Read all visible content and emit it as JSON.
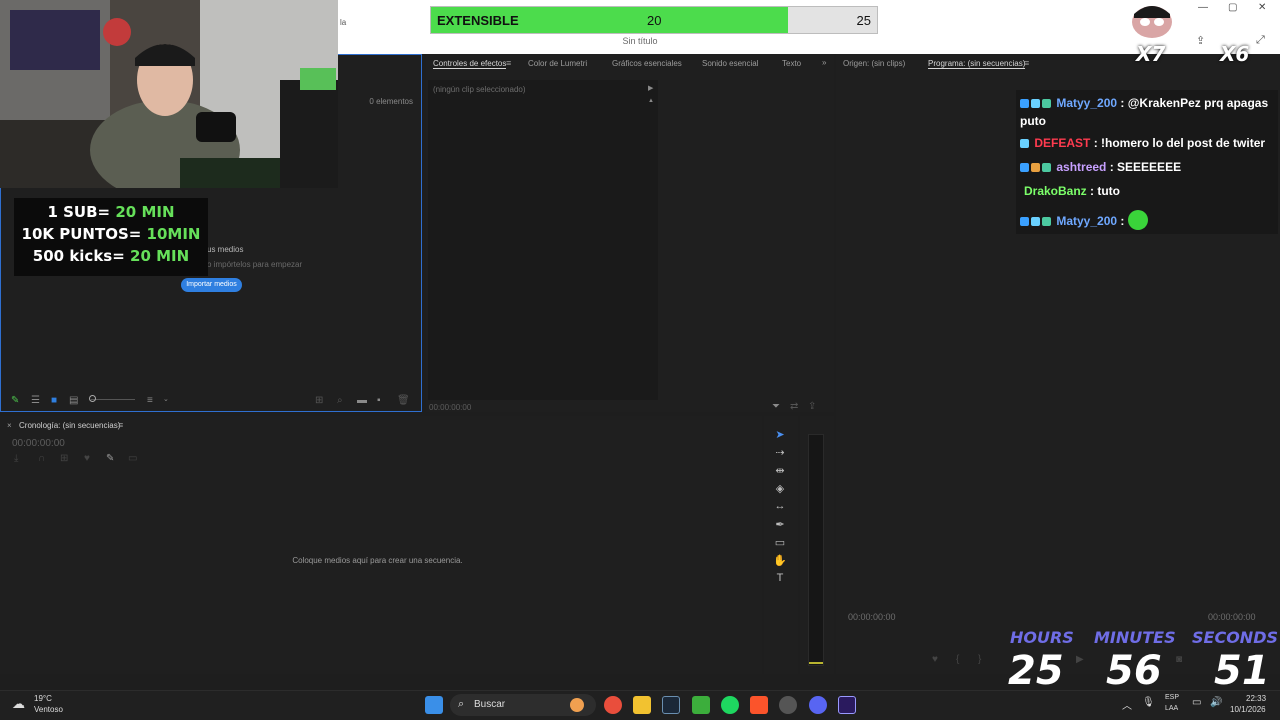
{
  "window": {
    "document_title": "Sin título",
    "partial_text": "la"
  },
  "goal_bar": {
    "label": "EXTENSIBLE",
    "current": "20",
    "target": "25",
    "progress_fraction": 0.8,
    "fill_color": "#4cdc4c"
  },
  "project_panel": {
    "item_count": "0 elementos",
    "empty_title_partial": "us medios",
    "empty_hint_partial": "o impórtelos para empezar",
    "import_button": "Importar medios",
    "accent_color": "#2f7fe0"
  },
  "effects_panel": {
    "tabs": [
      "Controles de efectos",
      "Color de Lumetri",
      "Gráficos esenciales",
      "Sonido esencial",
      "Texto"
    ],
    "no_clip": "(ningún clip seleccionado)",
    "timecode": "00:00:00:00"
  },
  "monitors": {
    "source_tab": "Origen: (sin clips)",
    "program_tab": "Programa: (sin secuencias)",
    "timecode_left": "00:00:00:00",
    "timecode_right": "00:00:00:00"
  },
  "timeline": {
    "tab": "Cronología: (sin secuencias)",
    "timecode": "00:00:00:00",
    "drop_hint": "Coloque medios aquí para crear una secuencia."
  },
  "stream_rules": {
    "line1_prefix": "1 SUB= ",
    "line1_value": "20 MIN",
    "line2_prefix": "10K PUNTOS= ",
    "line2_value": "10MIN",
    "line3_prefix": "500 kicks= ",
    "line3_value": "20 MIN"
  },
  "chat": {
    "messages": [
      {
        "user": "Matyy_200",
        "text": " : @KrakenPez prq apagas puto",
        "color": "#6fa8ff"
      },
      {
        "user": "DEFEAST",
        "text": " : !homero lo del post de twiter",
        "color": "#ff3b4f"
      },
      {
        "user": "ashtreed",
        "text": " : SEEEEEEE",
        "color": "#c7a0ff"
      },
      {
        "user": "DrakoBanz",
        "text": " : tuto",
        "color": "#7cff6a"
      },
      {
        "user": "Matyy_200",
        "text": " : ",
        "color": "#6fa8ff"
      }
    ]
  },
  "countdown": {
    "hours_label": "HOURS",
    "minutes_label": "MINUTES",
    "seconds_label": "SECONDS",
    "hours": "25",
    "minutes": "56",
    "seconds": "51"
  },
  "emote_overlay": {
    "left_count": "X7",
    "right_count": "X6"
  },
  "taskbar": {
    "weather_temp": "19°C",
    "weather_desc": "Ventoso",
    "search_placeholder": "Buscar",
    "lang": "ESP",
    "lang_sub": "LAA",
    "time": "22:33",
    "date": "10/1/2026"
  }
}
